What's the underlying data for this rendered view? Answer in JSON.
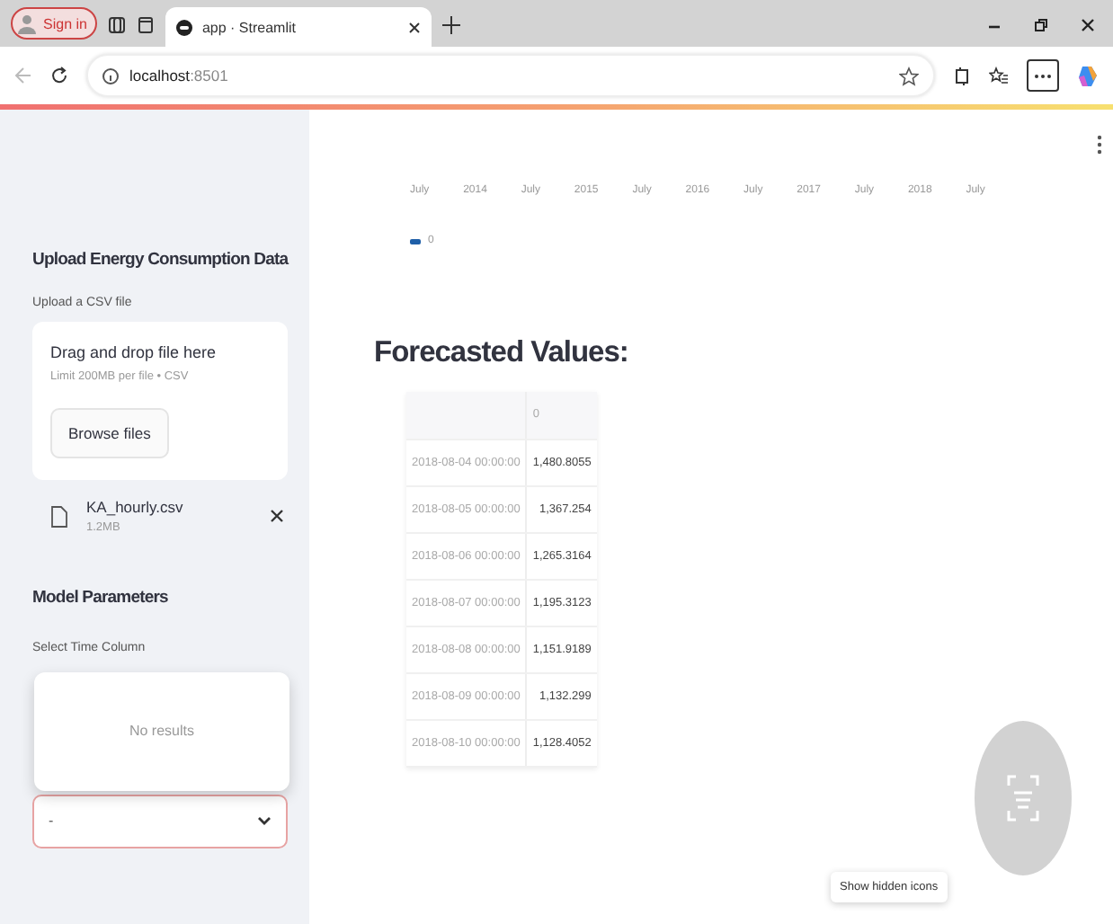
{
  "browser": {
    "profile_button": "Sign in",
    "tabs": [
      {
        "title": "app · Streamlit",
        "selected": true
      }
    ],
    "address": {
      "host": "localhost",
      "port": ":8501"
    }
  },
  "sidebar": {
    "upload_heading": "Upload Energy Consumption Data",
    "uploader": {
      "label": "Upload a CSV file",
      "drop_text": "Drag and drop file here",
      "limit": "Limit 200MB per file • CSV",
      "button": "Browse files"
    },
    "file": {
      "name": "KA_hourly.csv",
      "size": "1.2MB"
    },
    "params_heading": "Model Parameters",
    "select": {
      "label": "Select Time Column",
      "value": "-",
      "open": true,
      "dropdown_message": "No results"
    }
  },
  "chart": {
    "axis_labels": [
      "July",
      "2014",
      "July",
      "2015",
      "July",
      "2016",
      "July",
      "2017",
      "July",
      "2018",
      "July"
    ],
    "legend": [
      {
        "label": "0",
        "color": "#1f5fa8"
      }
    ]
  },
  "forecast": {
    "title": "Forecasted Values:",
    "columns": [
      "",
      "0"
    ],
    "rows": [
      {
        "date": "2018-08-04 00:00:00",
        "value": "1,480.8055"
      },
      {
        "date": "2018-08-05 00:00:00",
        "value": "1,367.254"
      },
      {
        "date": "2018-08-06 00:00:00",
        "value": "1,265.3164"
      },
      {
        "date": "2018-08-07 00:00:00",
        "value": "1,195.3123"
      },
      {
        "date": "2018-08-08 00:00:00",
        "value": "1,151.9189"
      },
      {
        "date": "2018-08-09 00:00:00",
        "value": "1,132.299"
      },
      {
        "date": "2018-08-10 00:00:00",
        "value": "1,128.4052"
      }
    ]
  },
  "tooltip": "Show hidden icons"
}
